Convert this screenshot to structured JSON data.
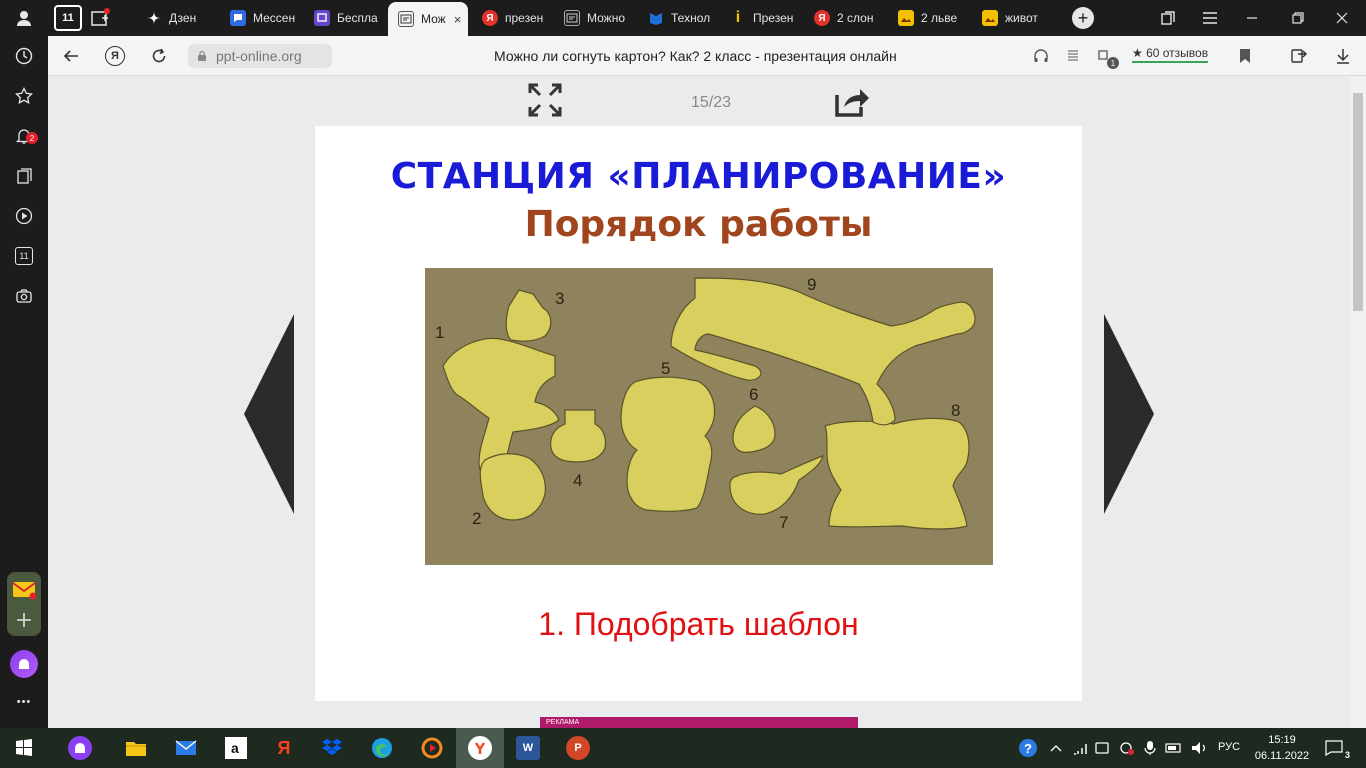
{
  "tabs": [
    {
      "label": "Дзен",
      "fav": "dzen-icon",
      "color": "#000000"
    },
    {
      "label": "Мессен",
      "fav": "messenger-icon",
      "color": "#2f6be5"
    },
    {
      "label": "Беспла",
      "fav": "twitch-icon",
      "color": "#6646c9"
    },
    {
      "label": "Мож",
      "fav": "ppt-icon",
      "color": "#333333",
      "active": true
    },
    {
      "label": "презен",
      "fav": "yandex-icon",
      "color": "#e5312b"
    },
    {
      "label": "Можно",
      "fav": "ppt-icon",
      "color": "#888888"
    },
    {
      "label": "Технол",
      "fav": "bookmark-icon",
      "color": "#1e6fd9"
    },
    {
      "label": "Презен",
      "fav": "info-icon",
      "color": "#f2c200"
    },
    {
      "label": "2 слон",
      "fav": "yandex-icon",
      "color": "#e5312b"
    },
    {
      "label": "2 льве",
      "fav": "image-icon",
      "color": "#f2c200"
    },
    {
      "label": "живот",
      "fav": "image-icon",
      "color": "#f2c200"
    }
  ],
  "tab_close": "×",
  "tab_new": "+",
  "ya_letter": "Я",
  "tab_badge": "11",
  "address": {
    "url": "ppt-online.org",
    "title": "Можно ли согнуть картон? Как? 2 класс - презентация онлайн",
    "reviews": "★ 60 отзывов",
    "ext_badge": "1"
  },
  "sidebar": {
    "notif_badge": "2",
    "cal_label": "11",
    "more": "•••"
  },
  "viewer": {
    "page": "15/23"
  },
  "slide": {
    "title": "СТАНЦИЯ «ПЛАНИРОВАНИЕ»",
    "subtitle": "Порядок работы",
    "step": "1. Подобрать шаблон",
    "template_numbers": [
      "1",
      "2",
      "3",
      "4",
      "5",
      "6",
      "7",
      "8",
      "9"
    ]
  },
  "ad": {
    "label": "РЕКЛАМА"
  },
  "taskbar": {
    "lang": "РУС",
    "time": "15:19",
    "date": "06.11.2022",
    "notif_count": "3",
    "word_letter": "W",
    "ppt_letter": "P",
    "ya_letter": "Я"
  }
}
